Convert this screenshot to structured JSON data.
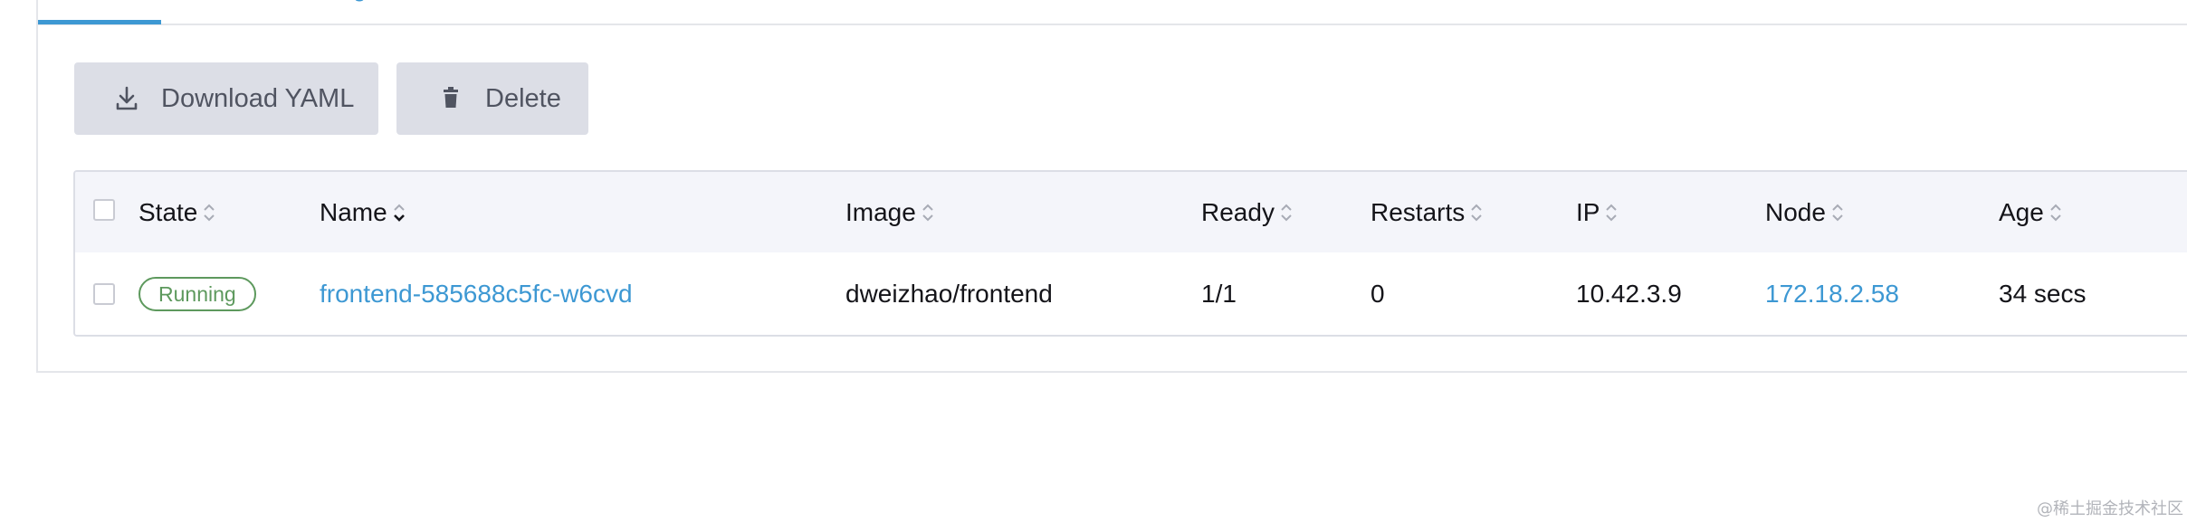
{
  "tabs": {
    "partial_label": "g"
  },
  "toolbar": {
    "download_label": "Download YAML",
    "delete_label": "Delete",
    "download_icon": "download-icon",
    "delete_icon": "trash-icon"
  },
  "table": {
    "columns": [
      {
        "label": "State",
        "sort": "none"
      },
      {
        "label": "Name",
        "sort": "descending"
      },
      {
        "label": "Image",
        "sort": "none"
      },
      {
        "label": "Ready",
        "sort": "none"
      },
      {
        "label": "Restarts",
        "sort": "none"
      },
      {
        "label": "IP",
        "sort": "none"
      },
      {
        "label": "Node",
        "sort": "none"
      },
      {
        "label": "Age",
        "sort": "none"
      }
    ],
    "rows": [
      {
        "state": "Running",
        "name": "frontend-585688c5fc-w6cvd",
        "image": "dweizhao/frontend",
        "ready": "1/1",
        "restarts": "0",
        "ip": "10.42.3.9",
        "node": "172.18.2.58",
        "age": "34 secs"
      }
    ]
  },
  "watermark": "@稀土掘金技术社区",
  "colors": {
    "accent": "#3d98d3",
    "running": "#5d995d",
    "button_bg": "#dcdee6",
    "header_bg": "#f4f5fa"
  }
}
